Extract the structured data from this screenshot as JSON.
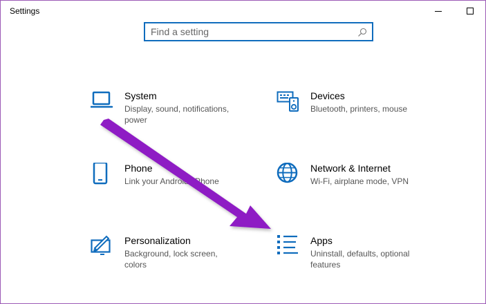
{
  "window": {
    "title": "Settings"
  },
  "search": {
    "placeholder": "Find a setting",
    "value": ""
  },
  "categories": [
    {
      "title": "System",
      "description": "Display, sound, notifications, power",
      "icon": "laptop-icon"
    },
    {
      "title": "Devices",
      "description": "Bluetooth, printers, mouse",
      "icon": "devices-icon"
    },
    {
      "title": "Phone",
      "description": "Link your Android, iPhone",
      "icon": "phone-icon"
    },
    {
      "title": "Network & Internet",
      "description": "Wi-Fi, airplane mode, VPN",
      "icon": "globe-icon"
    },
    {
      "title": "Personalization",
      "description": "Background, lock screen, colors",
      "icon": "paintbrush-icon"
    },
    {
      "title": "Apps",
      "description": "Uninstall, defaults, optional features",
      "icon": "apps-list-icon"
    }
  ],
  "colors": {
    "accent": "#0f6cbd",
    "annotation_arrow": "#8e1cc4",
    "window_border": "#9b59b6"
  }
}
